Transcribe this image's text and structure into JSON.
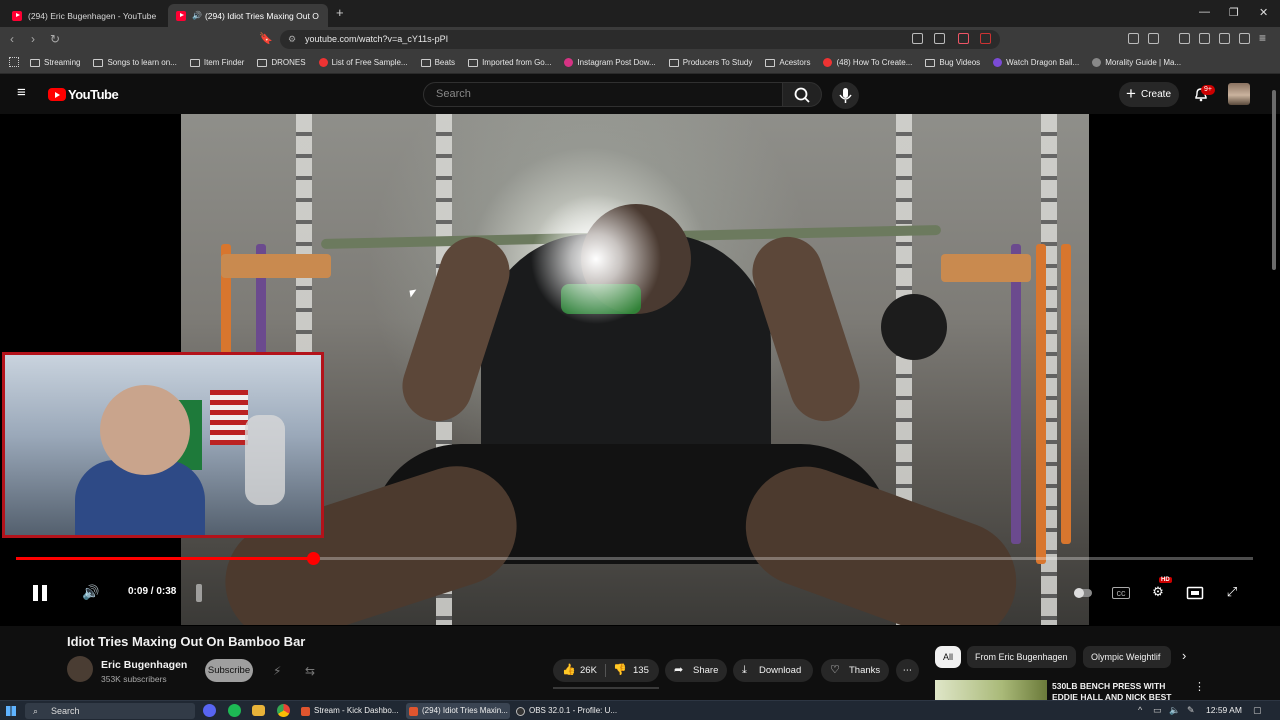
{
  "browser": {
    "tabs": [
      {
        "label": "(294) Eric Bugenhagen - YouTube",
        "active": false
      },
      {
        "label": "(294) Idiot Tries Maxing Out O",
        "active": true
      }
    ],
    "new_tab_icon": "plus-icon",
    "url": "youtube.com/watch?v=a_cY11s-pPI",
    "bookmarks": [
      "Streaming",
      "Songs to learn on...",
      "Item Finder",
      "DRONES",
      "List of Free Sample...",
      "Beats",
      "Imported from Go...",
      "Instagram Post Dow...",
      "Producers To Study",
      "Acestors",
      "(48) How To Create...",
      "Bug Videos",
      "Watch Dragon Ball...",
      "Morality Guide | Ma..."
    ]
  },
  "youtube": {
    "logo_text": "YouTube",
    "search_placeholder": "Search",
    "create_label": "Create",
    "notifications_badge": "9+"
  },
  "player": {
    "time_display": "0:09 / 0:38",
    "progress_fraction": 0.24,
    "hd_badge": "HD",
    "colors": {
      "progress": "#ff0000",
      "webcam_border": "#b3121a"
    }
  },
  "video": {
    "title": "Idiot Tries Maxing Out On Bamboo Bar",
    "channel": "Eric Bugenhagen",
    "subscribers": "353K subscribers",
    "subscribe_label": "Subscribe",
    "likes": "26K",
    "dislikes": "135",
    "share_label": "Share",
    "download_label": "Download",
    "thanks_label": "Thanks"
  },
  "sidebar": {
    "chips": [
      "All",
      "From Eric Bugenhagen",
      "Olympic Weightlif"
    ],
    "recommendation_title": "530LB BENCH PRESS WITH EDDIE HALL AND NICK BEST"
  },
  "taskbar": {
    "search_label": "Search",
    "items": [
      "Stream - Kick Dashbo...",
      "(294) Idiot Tries Maxin...",
      "OBS 32.0.1 - Profile: U..."
    ],
    "clock": "12:59 AM"
  }
}
